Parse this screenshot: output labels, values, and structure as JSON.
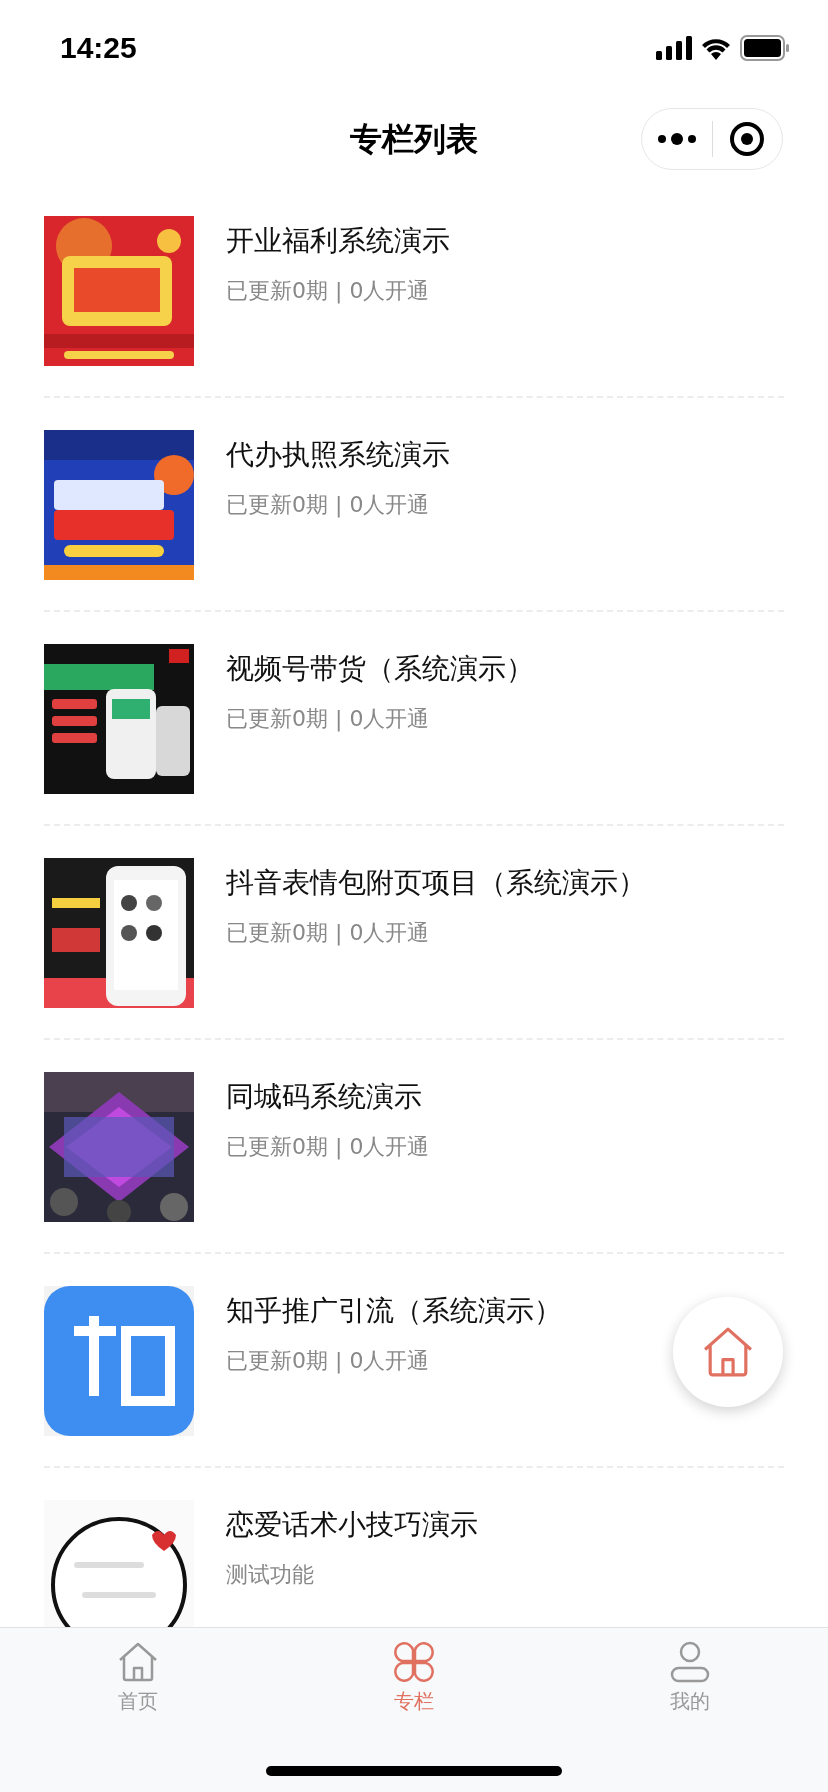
{
  "status_bar": {
    "time": "14:25"
  },
  "header": {
    "title": "专栏列表"
  },
  "columns": [
    {
      "title": "开业福利系统演示",
      "stats": "已更新0期 | 0人开通"
    },
    {
      "title": "代办执照系统演示",
      "stats": "已更新0期 | 0人开通"
    },
    {
      "title": "视频号带货（系统演示）",
      "stats": "已更新0期 | 0人开通"
    },
    {
      "title": "抖音表情包附页项目（系统演示）",
      "stats": "已更新0期 | 0人开通"
    },
    {
      "title": "同城码系统演示",
      "stats": "已更新0期 | 0人开通"
    },
    {
      "title": "知乎推广引流（系统演示）",
      "stats": "已更新0期 | 0人开通"
    },
    {
      "title": "恋爱话术小技巧演示",
      "description": "测试功能"
    }
  ],
  "tab_bar": [
    {
      "label": "首页",
      "kind": "home",
      "selected": false
    },
    {
      "label": "专栏",
      "kind": "grid",
      "selected": true
    },
    {
      "label": "我的",
      "kind": "person",
      "selected": false
    }
  ]
}
